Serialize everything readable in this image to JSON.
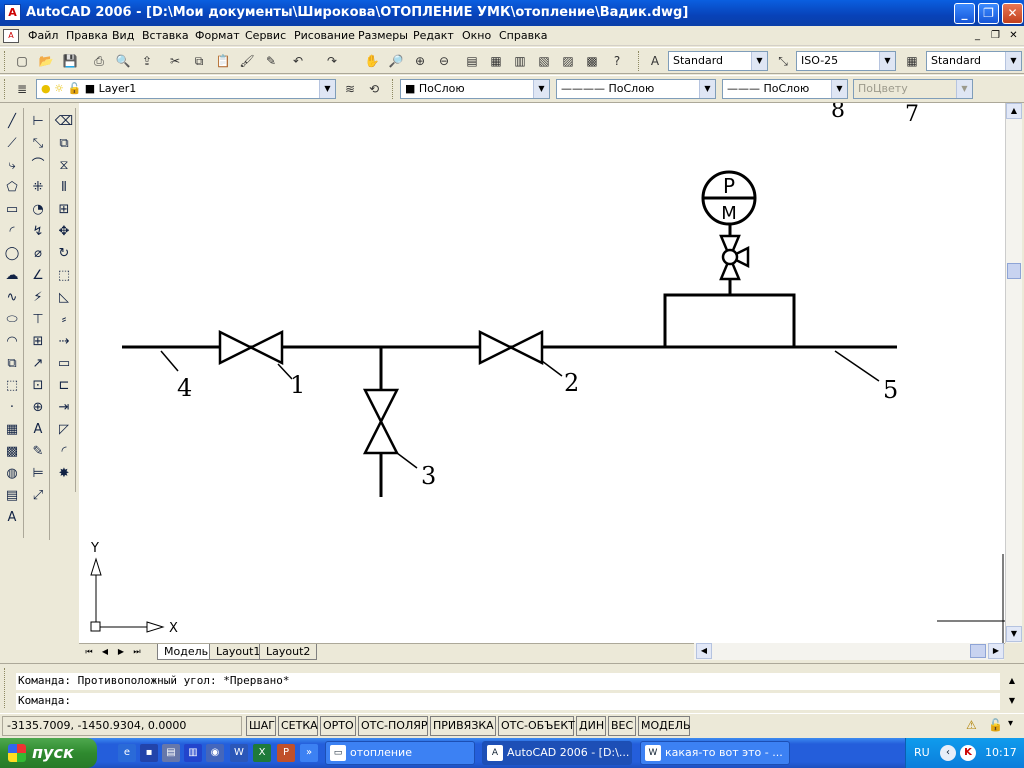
{
  "window": {
    "title": "AutoCAD 2006 - [D:\\Мои документы\\Широкова\\ОТОПЛЕНИЕ УМК\\отопление\\Вадик.dwg]",
    "app_icon": "autocad-icon"
  },
  "menu": {
    "items": [
      "Файл",
      "Правка",
      "Вид",
      "Вставка",
      "Формат",
      "Сервис",
      "Рисование",
      "Размеры",
      "Редакт",
      "Окно",
      "Справка"
    ]
  },
  "toolbar": {
    "text_style": "Standard",
    "dim_style": "ISO-25",
    "table_style": "Standard"
  },
  "layers": {
    "current_layer": "Layer1",
    "color": "ПоСлою",
    "linetype": "ПоСлою",
    "lineweight": "ПоСлою",
    "plotstyle": "ПоЦвету"
  },
  "drawing": {
    "labels": {
      "valve1": "1",
      "valve2": "2",
      "valve3": "3",
      "pipe4": "4",
      "pipe5": "5",
      "top8": "8",
      "top7": "7"
    },
    "gauge_top": "P",
    "gauge_bottom": "M",
    "ucs_x": "X",
    "ucs_y": "Y"
  },
  "tabs": [
    "Модель",
    "Layout1",
    "Layout2"
  ],
  "command": {
    "history": "Команда: Противоположный угол: *Прервано*",
    "prompt": "Команда:"
  },
  "status": {
    "coordinates": "-3135.7009, -1450.9304, 0.0000",
    "toggles": [
      "ШАГ",
      "СЕТКА",
      "ОРТО",
      "ОТС-ПОЛЯР",
      "ПРИВЯЗКА",
      "ОТС-ОБЪЕКТ",
      "ДИН",
      "ВЕС",
      "МОДЕЛЬ"
    ]
  },
  "taskbar": {
    "start_label": "пуск",
    "tasks": [
      "отопление",
      "AutoCAD 2006 - [D:\\...",
      "какая-то вот это - ..."
    ],
    "lang": "RU",
    "time": "10:17"
  }
}
